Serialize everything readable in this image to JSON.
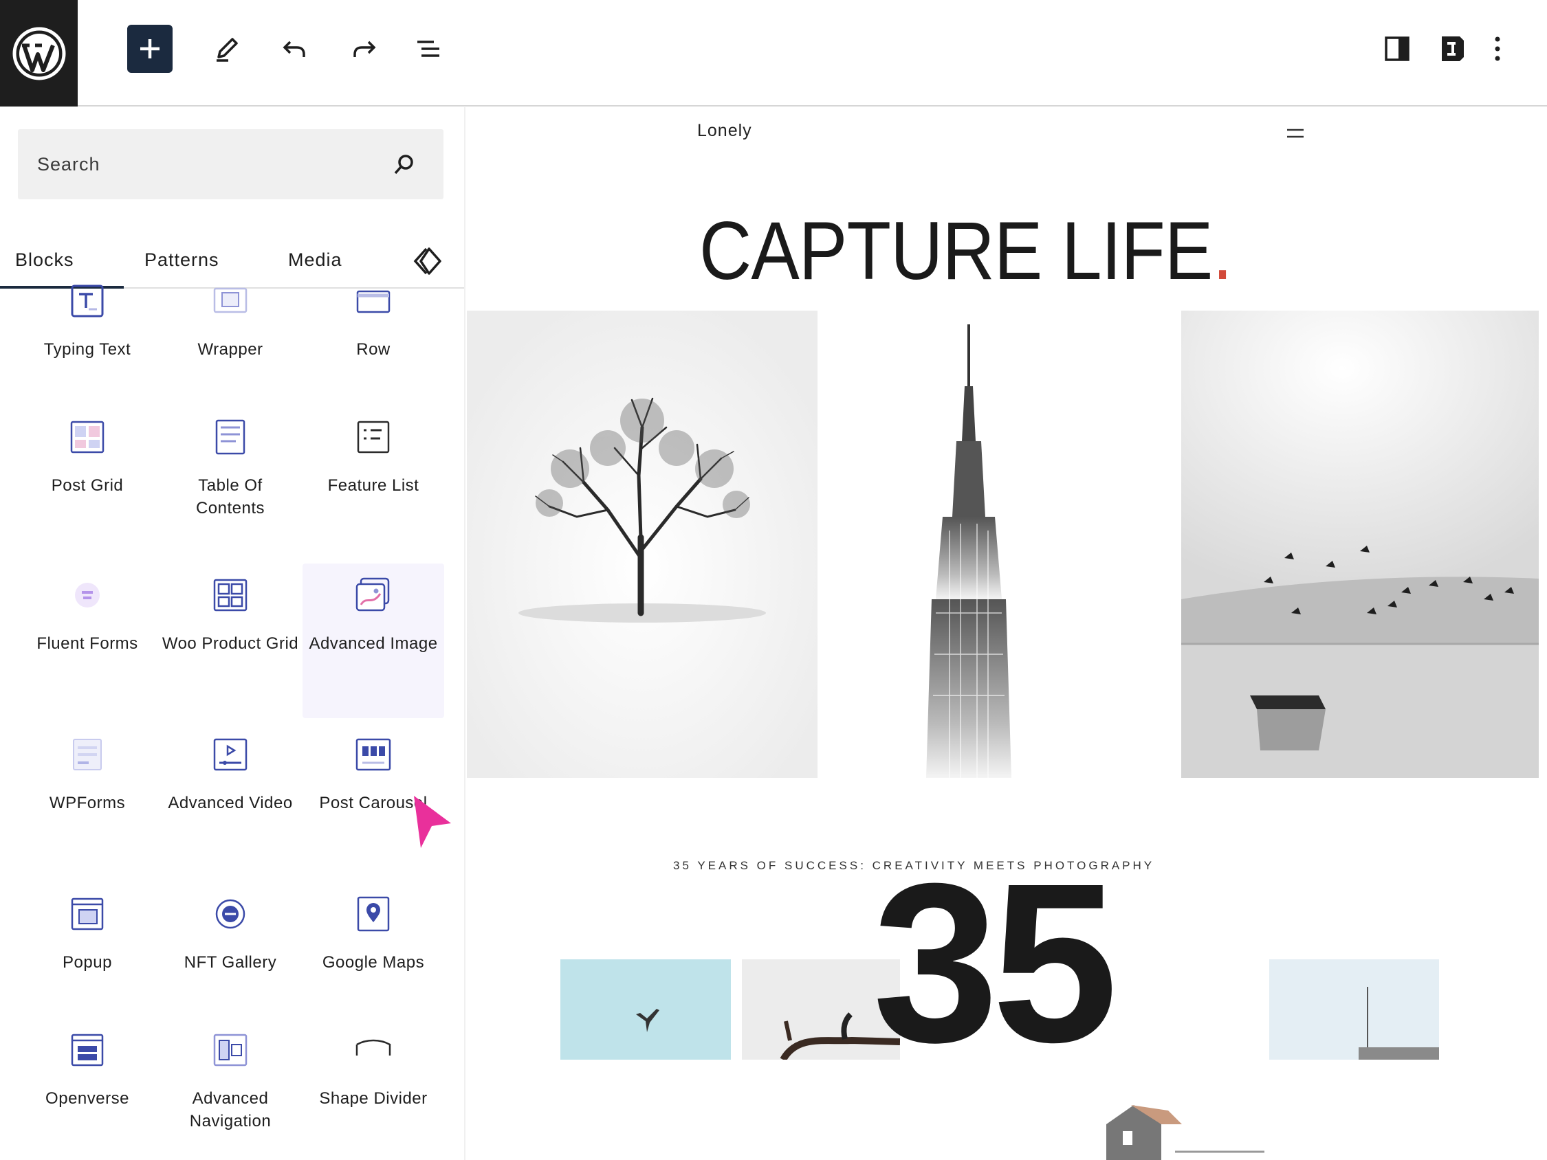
{
  "toolbar": {
    "icons": [
      "wordpress-logo",
      "plus-icon",
      "pencil-icon",
      "undo-icon",
      "redo-icon",
      "document-overview-icon",
      "sidebar-icon",
      "styles-icon",
      "more-vertical-icon"
    ]
  },
  "inserter": {
    "search": {
      "placeholder": "Search",
      "value": ""
    },
    "tabs": [
      {
        "label": "Blocks",
        "active": true
      },
      {
        "label": "Patterns",
        "active": false
      },
      {
        "label": "Media",
        "active": false
      }
    ],
    "blocks": [
      {
        "label": "Typing Text"
      },
      {
        "label": "Wrapper"
      },
      {
        "label": "Row"
      },
      {
        "label": "Post Grid"
      },
      {
        "label": "Table Of Contents"
      },
      {
        "label": "Feature List"
      },
      {
        "label": "Fluent Forms"
      },
      {
        "label": "Woo Product Grid"
      },
      {
        "label": "Advanced Image"
      },
      {
        "label": "WPForms"
      },
      {
        "label": "Advanced Video"
      },
      {
        "label": "Post Carousel"
      },
      {
        "label": "Popup"
      },
      {
        "label": "NFT Gallery"
      },
      {
        "label": "Google Maps"
      },
      {
        "label": "Openverse"
      },
      {
        "label": "Advanced Navigation"
      },
      {
        "label": "Shape Divider"
      }
    ]
  },
  "canvas": {
    "site_title": "Lonely",
    "hero_title": "CAPTURE LIFE",
    "hero_dot": ".",
    "tagline": "35 YEARS OF SUCCESS: CREATIVITY MEETS PHOTOGRAPHY",
    "big_number": "35",
    "colors": {
      "accent": "#d24a3a",
      "primary": "#1b2a3f",
      "cursor": "#e9309b"
    }
  }
}
